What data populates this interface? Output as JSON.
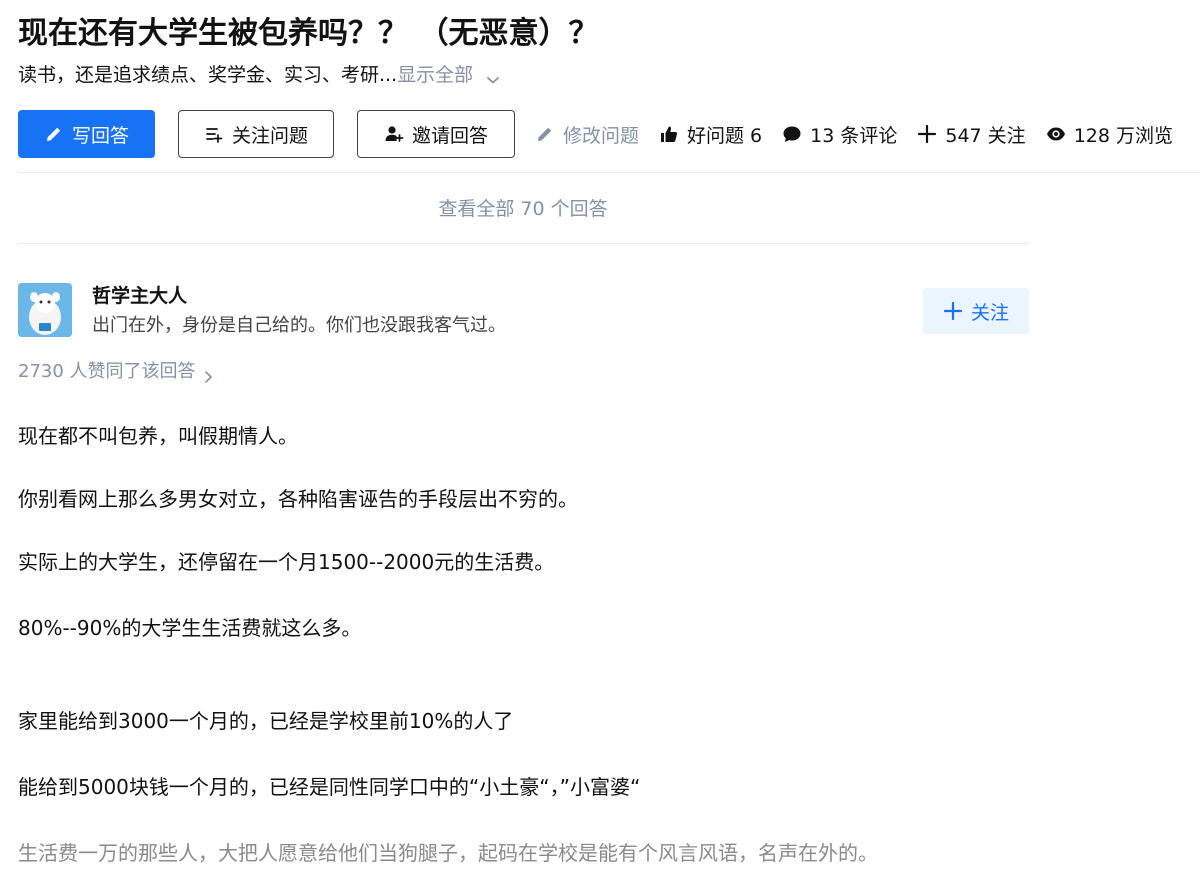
{
  "question": {
    "title": "现在还有大学生被包养吗？？ （无恶意）？",
    "detail": "读书，还是追求绩点、奖学金、实习、考研...",
    "show_all": "显示全部"
  },
  "actions": {
    "write_answer": "写回答",
    "follow_question": "关注问题",
    "invite_answer": "邀请回答",
    "edit_question": "修改问题",
    "good_question": "好问题 6",
    "comments": "13 条评论",
    "followers": "547 关注",
    "views": "128 万浏览"
  },
  "view_all_answers": "查看全部 70 个回答",
  "answer": {
    "author": {
      "name": "哲学主大人",
      "bio": "出门在外，身份是自己给的。你们也没跟我客气过。",
      "follow_label": "关注"
    },
    "voters": "2730 人赞同了该回答",
    "paragraphs": [
      "现在都不叫包养，叫假期情人。",
      "你别看网上那么多男女对立，各种陷害诬告的手段层出不穷的。",
      "实际上的大学生，还停留在一个月1500--2000元的生活费。",
      "80%--90%的大学生生活费就这么多。",
      "家里能给到3000一个月的，已经是学校里前10%的人了",
      "能给到5000块钱一个月的，已经是同性同学口中的“小土豪“，”小富婆“",
      "生活费一万的那些人，大把人愿意给他们当狗腿子，起码在学校是能有个风言风语，名声在外的。"
    ]
  },
  "colors": {
    "primary": "#1772f6",
    "muted": "#8590a6",
    "follow_bg": "#ebf5ff",
    "avatar_bg": "#6db7e8"
  },
  "icons": [
    "pencil-icon",
    "follow-list-icon",
    "invite-user-icon",
    "edit-pencil-icon",
    "thumbs-up-icon",
    "comment-bubble-icon",
    "plus-icon",
    "eye-icon",
    "chevron-down-icon",
    "chevron-right-icon",
    "avatar-illustration"
  ]
}
